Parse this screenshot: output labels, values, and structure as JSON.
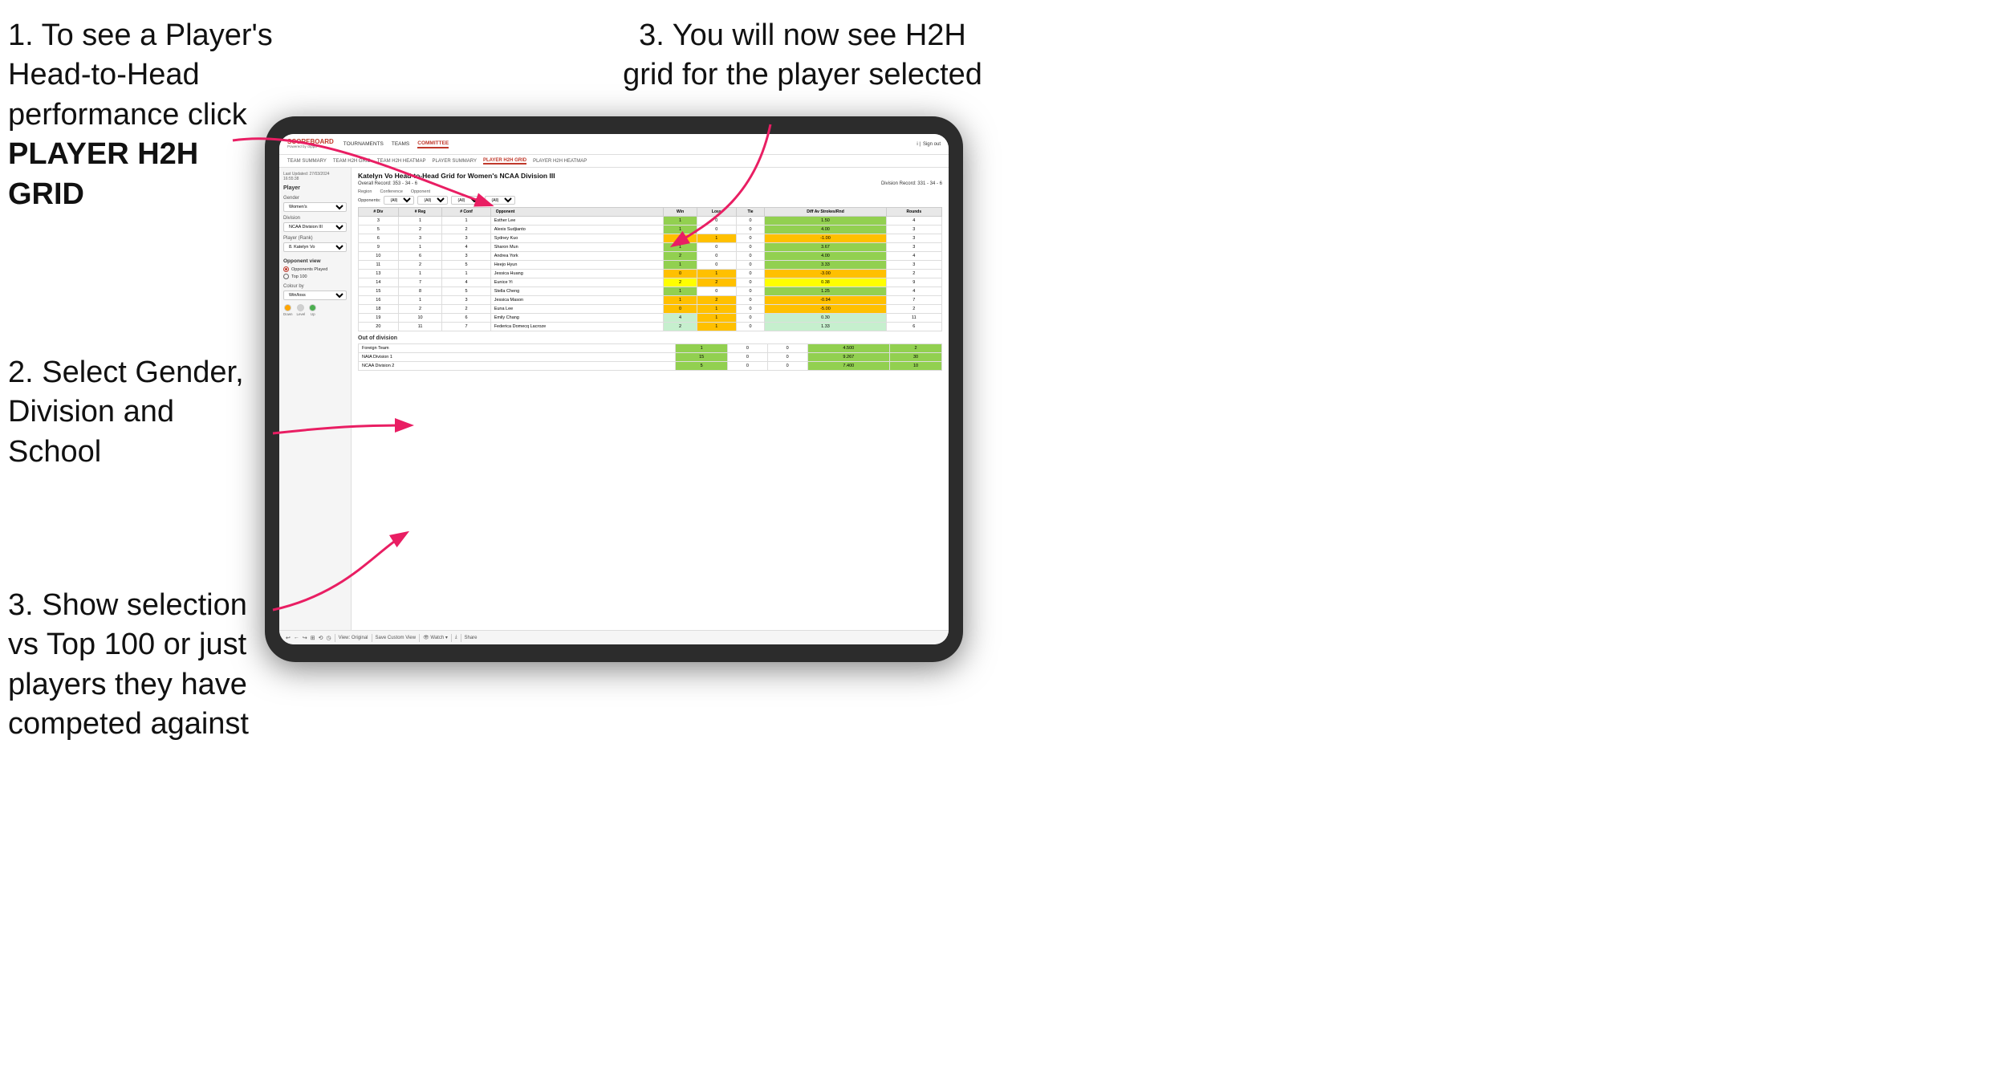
{
  "instructions": {
    "step1": "1. To see a Player's Head-to-Head performance click",
    "step1_bold": "PLAYER H2H GRID",
    "step2": "2. Select Gender, Division and School",
    "step3_top": "3. You will now see H2H grid for the player selected",
    "step3_bottom": "3. Show selection vs Top 100 or just players they have competed against"
  },
  "app": {
    "logo": "SCOREBOARD",
    "logo_sub": "Powered by clippd",
    "nav": [
      "TOURNAMENTS",
      "TEAMS",
      "COMMITTEE"
    ],
    "subnav": [
      "TEAM SUMMARY",
      "TEAM H2H GRID",
      "TEAM H2H HEATMAP",
      "PLAYER SUMMARY",
      "PLAYER H2H GRID",
      "PLAYER H2H HEATMAP"
    ],
    "active_nav": "COMMITTEE",
    "active_subnav": "PLAYER H2H GRID",
    "sign_out": "Sign out"
  },
  "panel": {
    "last_updated_label": "Last Updated: 27/03/2024",
    "last_updated_time": "16:55:38",
    "player_label": "Player",
    "gender_label": "Gender",
    "gender_value": "Women's",
    "division_label": "Division",
    "division_value": "NCAA Division III",
    "player_rank_label": "Player (Rank)",
    "player_rank_value": "8. Katelyn Vo",
    "opponent_view_label": "Opponent view",
    "radio1": "Opponents Played",
    "radio2": "Top 100",
    "colour_by_label": "Colour by",
    "colour_value": "Win/loss",
    "colour_down": "Down",
    "colour_level": "Level",
    "colour_up": "Up"
  },
  "grid": {
    "title": "Katelyn Vo Head-to-Head Grid for Women's NCAA Division III",
    "overall_record": "Overall Record: 353 - 34 - 6",
    "division_record": "Division Record: 331 - 34 - 6",
    "region_label": "Region",
    "conference_label": "Conference",
    "opponent_label": "Opponent",
    "opponents_label": "Opponents:",
    "opponents_filter": "(All)",
    "region_filter": "(All)",
    "conference_filter": "(All)",
    "opponent_filter": "(All)",
    "columns": [
      "# Div",
      "# Reg",
      "# Conf",
      "Opponent",
      "Win",
      "Loss",
      "Tie",
      "Diff Av Strokes/Rnd",
      "Rounds"
    ],
    "rows": [
      {
        "div": "3",
        "reg": "1",
        "conf": "1",
        "opponent": "Esther Lee",
        "win": 1,
        "loss": 0,
        "tie": 0,
        "diff": "1.50",
        "rounds": 4,
        "win_color": "green"
      },
      {
        "div": "5",
        "reg": "2",
        "conf": "2",
        "opponent": "Alexis Sudjianto",
        "win": 1,
        "loss": 0,
        "tie": 0,
        "diff": "4.00",
        "rounds": 3,
        "win_color": "green"
      },
      {
        "div": "6",
        "reg": "3",
        "conf": "3",
        "opponent": "Sydney Kuo",
        "win": 0,
        "loss": 1,
        "tie": 0,
        "diff": "-1.00",
        "rounds": 3,
        "win_color": "orange"
      },
      {
        "div": "9",
        "reg": "1",
        "conf": "4",
        "opponent": "Sharon Mun",
        "win": 1,
        "loss": 0,
        "tie": 0,
        "diff": "3.67",
        "rounds": 3,
        "win_color": "green"
      },
      {
        "div": "10",
        "reg": "6",
        "conf": "3",
        "opponent": "Andrea York",
        "win": 2,
        "loss": 0,
        "tie": 0,
        "diff": "4.00",
        "rounds": 4,
        "win_color": "green"
      },
      {
        "div": "11",
        "reg": "2",
        "conf": "5",
        "opponent": "Heejo Hyun",
        "win": 1,
        "loss": 0,
        "tie": 0,
        "diff": "3.33",
        "rounds": 3,
        "win_color": "green"
      },
      {
        "div": "13",
        "reg": "1",
        "conf": "1",
        "opponent": "Jessica Huang",
        "win": 0,
        "loss": 1,
        "tie": 0,
        "diff": "-3.00",
        "rounds": 2,
        "win_color": "orange"
      },
      {
        "div": "14",
        "reg": "7",
        "conf": "4",
        "opponent": "Eunice Yi",
        "win": 2,
        "loss": 2,
        "tie": 0,
        "diff": "0.38",
        "rounds": 9,
        "win_color": "yellow"
      },
      {
        "div": "15",
        "reg": "8",
        "conf": "5",
        "opponent": "Stella Cheng",
        "win": 1,
        "loss": 0,
        "tie": 0,
        "diff": "1.25",
        "rounds": 4,
        "win_color": "green"
      },
      {
        "div": "16",
        "reg": "1",
        "conf": "3",
        "opponent": "Jessica Mason",
        "win": 1,
        "loss": 2,
        "tie": 0,
        "diff": "-0.94",
        "rounds": 7,
        "win_color": "orange"
      },
      {
        "div": "18",
        "reg": "2",
        "conf": "2",
        "opponent": "Euna Lee",
        "win": 0,
        "loss": 1,
        "tie": 0,
        "diff": "-5.00",
        "rounds": 2,
        "win_color": "orange"
      },
      {
        "div": "19",
        "reg": "10",
        "conf": "6",
        "opponent": "Emily Chang",
        "win": 4,
        "loss": 1,
        "tie": 0,
        "diff": "0.30",
        "rounds": 11,
        "win_color": "light-green"
      },
      {
        "div": "20",
        "reg": "11",
        "conf": "7",
        "opponent": "Federica Domecq Lacroze",
        "win": 2,
        "loss": 1,
        "tie": 0,
        "diff": "1.33",
        "rounds": 6,
        "win_color": "light-green"
      }
    ],
    "out_of_division_title": "Out of division",
    "out_of_division_rows": [
      {
        "opponent": "Foreign Team",
        "win": 1,
        "loss": 0,
        "tie": 0,
        "diff": "4.500",
        "rounds": 2
      },
      {
        "opponent": "NAIA Division 1",
        "win": 15,
        "loss": 0,
        "tie": 0,
        "diff": "9.267",
        "rounds": 30
      },
      {
        "opponent": "NCAA Division 2",
        "win": 5,
        "loss": 0,
        "tie": 0,
        "diff": "7.400",
        "rounds": 10
      }
    ]
  },
  "toolbar": {
    "buttons": [
      "↩",
      "←",
      "↪",
      "⊞",
      "⟲",
      "◷",
      "View: Original",
      "Save Custom View",
      "Watch ▾",
      "⤓",
      "⋮⋮",
      "Share"
    ]
  }
}
